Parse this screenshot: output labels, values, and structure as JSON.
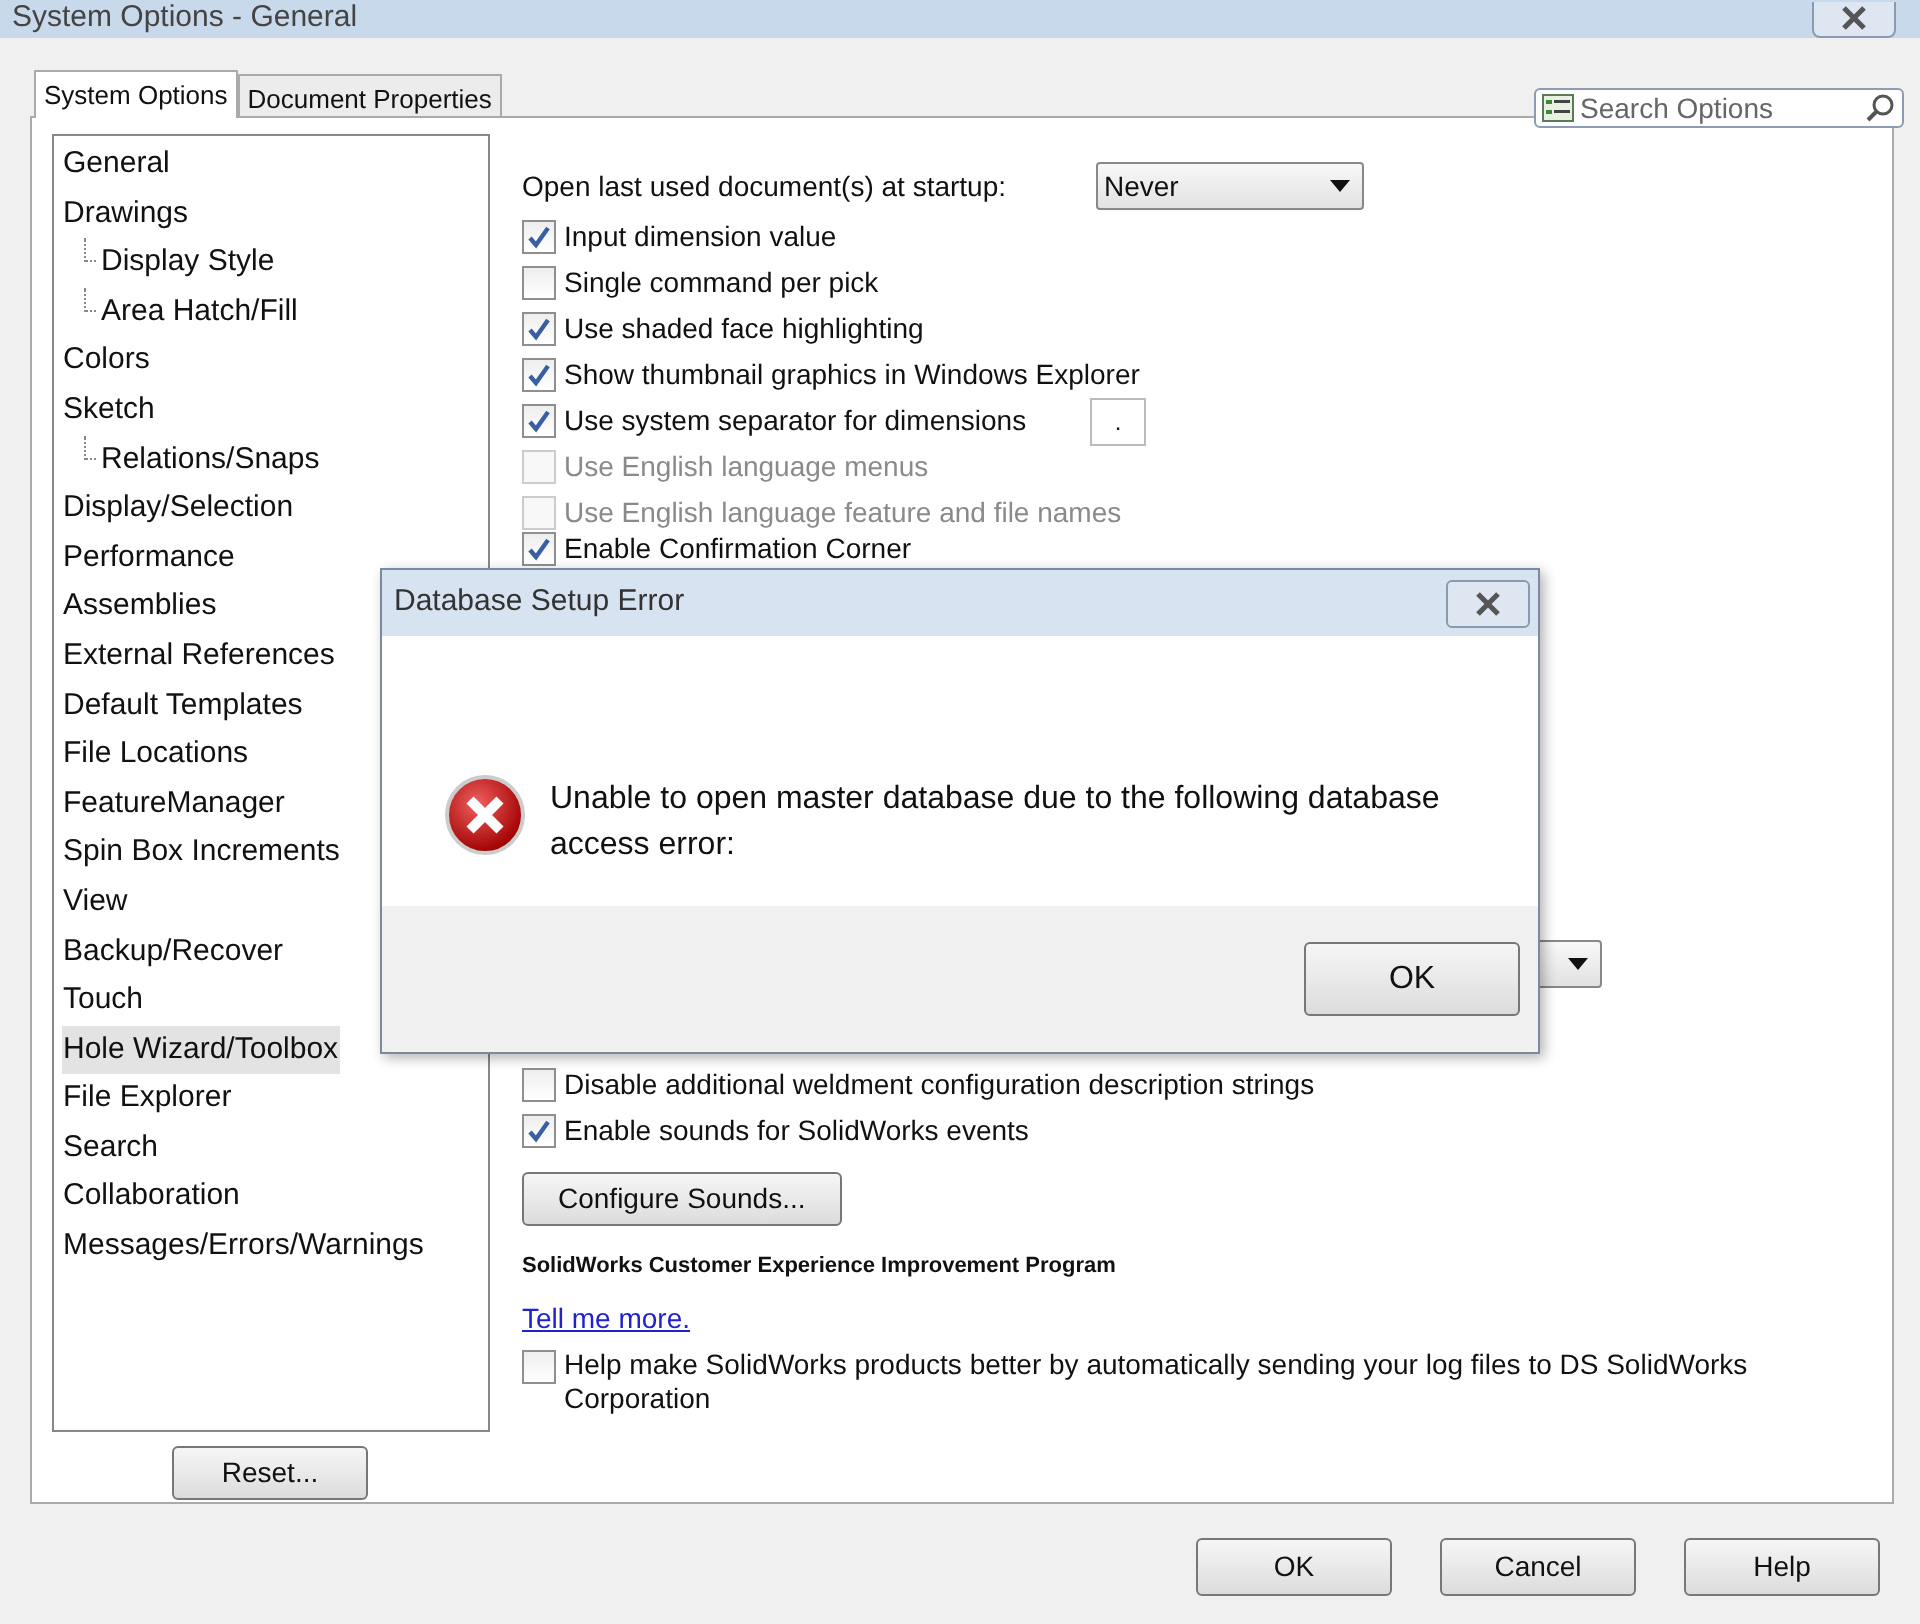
{
  "window": {
    "title": "System Options - General"
  },
  "search": {
    "placeholder": "Search Options"
  },
  "tabs": [
    {
      "label": "System Options",
      "selected": true
    },
    {
      "label": "Document Properties",
      "selected": false
    }
  ],
  "sidebar": {
    "items": [
      {
        "label": "General",
        "selected": false
      },
      {
        "label": "Drawings",
        "selected": false,
        "children": [
          {
            "label": "Display Style",
            "selected": false
          },
          {
            "label": "Area Hatch/Fill",
            "selected": false
          }
        ]
      },
      {
        "label": "Colors",
        "selected": false
      },
      {
        "label": "Sketch",
        "selected": false,
        "children": [
          {
            "label": "Relations/Snaps",
            "selected": false
          }
        ]
      },
      {
        "label": "Display/Selection",
        "selected": false
      },
      {
        "label": "Performance",
        "selected": false
      },
      {
        "label": "Assemblies",
        "selected": false
      },
      {
        "label": "External References",
        "selected": false
      },
      {
        "label": "Default Templates",
        "selected": false
      },
      {
        "label": "File Locations",
        "selected": false
      },
      {
        "label": "FeatureManager",
        "selected": false
      },
      {
        "label": "Spin Box Increments",
        "selected": false
      },
      {
        "label": "View",
        "selected": false
      },
      {
        "label": "Backup/Recover",
        "selected": false
      },
      {
        "label": "Touch",
        "selected": false
      },
      {
        "label": "Hole Wizard/Toolbox",
        "selected": true
      },
      {
        "label": "File Explorer",
        "selected": false
      },
      {
        "label": "Search",
        "selected": false
      },
      {
        "label": "Collaboration",
        "selected": false
      },
      {
        "label": "Messages/Errors/Warnings",
        "selected": false
      }
    ]
  },
  "options_top": [
    {
      "kind": "dropdown",
      "label": "Open last used document(s) at startup:",
      "value": "Never"
    },
    {
      "kind": "checkbox",
      "label": "Input dimension value",
      "checked": true,
      "disabled": false
    },
    {
      "kind": "checkbox",
      "label": "Single command per pick",
      "checked": false,
      "disabled": false
    },
    {
      "kind": "checkbox",
      "label": "Use shaded face highlighting",
      "checked": true,
      "disabled": false
    },
    {
      "kind": "checkbox",
      "label": "Show thumbnail graphics in Windows Explorer",
      "checked": true,
      "disabled": false
    },
    {
      "kind": "checkbox",
      "label": "Use system separator for dimensions",
      "checked": true,
      "disabled": false,
      "field_value": "."
    },
    {
      "kind": "checkbox",
      "label": "Use English language menus",
      "checked": false,
      "disabled": true
    },
    {
      "kind": "checkbox",
      "label": "Use English language feature and file names",
      "checked": false,
      "disabled": true
    },
    {
      "kind": "checkbox",
      "label": "Enable Confirmation Corner",
      "checked": true,
      "disabled": false
    }
  ],
  "options_bottom": [
    {
      "kind": "dropdown"
    },
    {
      "kind": "checkbox",
      "label": "Disable additional weldment configuration description strings",
      "checked": false,
      "disabled": false
    },
    {
      "kind": "checkbox",
      "label": "Enable sounds for SolidWorks events",
      "checked": true,
      "disabled": false
    },
    {
      "kind": "button",
      "label": "Configure Sounds..."
    },
    {
      "kind": "heading",
      "label": "SolidWorks Customer Experience Improvement Program"
    },
    {
      "kind": "link",
      "label": "Tell me more."
    },
    {
      "kind": "checkbox",
      "label": "Help make SolidWorks products better by automatically sending your log files to DS SolidWorks Corporation",
      "checked": false,
      "disabled": false
    }
  ],
  "reset_button": "Reset...",
  "footer_buttons": [
    "OK",
    "Cancel",
    "Help"
  ],
  "dialog": {
    "title": "Database Setup Error",
    "message": "Unable to open master database due to the following database access error:",
    "buttons": [
      "OK"
    ]
  }
}
